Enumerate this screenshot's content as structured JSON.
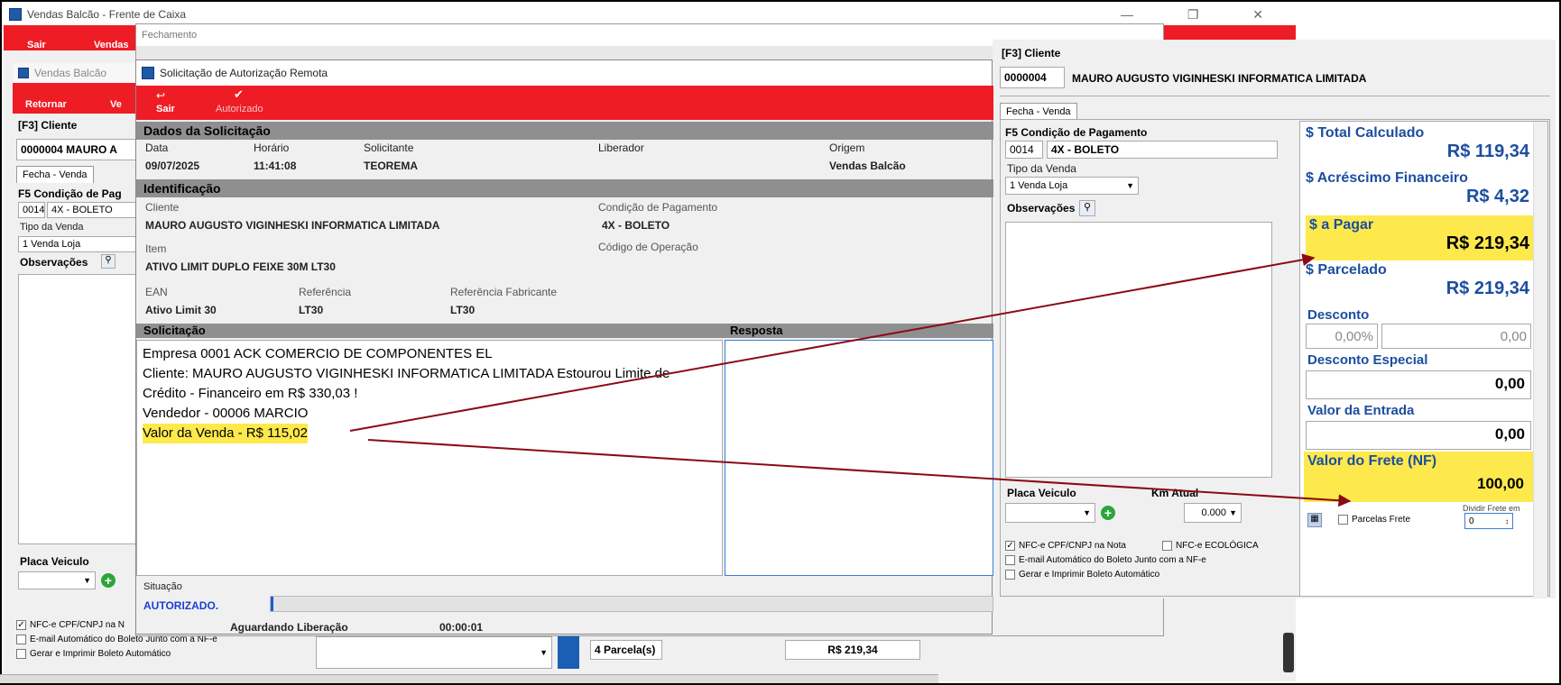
{
  "bg_window": {
    "title": "Vendas Balcão - Frente de Caixa",
    "btn_sair": "Sair",
    "btn_vendas": "Vendas"
  },
  "mid_window": {
    "title": "Fechamento"
  },
  "left_panel": {
    "title": "Vendas Balcão",
    "btn_retornar": "Retornar",
    "btn_ve": "Ve",
    "cliente_label": "[F3] Cliente",
    "cliente_code": "0000004",
    "cliente_name": "MAURO A",
    "tab": "Fecha - Venda",
    "cond_label": "F5 Condição de Pag",
    "cond_code": "0014",
    "cond_name": "4X - BOLETO",
    "tipo_label": "Tipo da Venda",
    "tipo_value": "1 Venda Loja",
    "obs_label": "Observações",
    "placa_label": "Placa Veiculo"
  },
  "bottom_left": {
    "chk1": "NFC-e CPF/CNPJ na N",
    "chk2": "E-mail Automático do Boleto Junto com a NF-e",
    "chk3": "Gerar e Imprimir Boleto Automático"
  },
  "bottom_bar": {
    "parcelas": "4 Parcela(s)",
    "total": "R$ 219,34"
  },
  "dialog": {
    "title": "Solicitação de Autorização Remota",
    "btn_sair": "Sair",
    "btn_autorizado": "Autorizado",
    "sec_dados": "Dados da Solicitação",
    "col_data": "Data",
    "col_horario": "Horário",
    "col_solicitante": "Solicitante",
    "col_liberador": "Liberador",
    "col_origem": "Origem",
    "val_data": "09/07/2025",
    "val_horario": "11:41:08",
    "val_solicitante": "TEOREMA",
    "val_liberador": "",
    "val_origem": "Vendas Balcão",
    "sec_ident": "Identificação",
    "lbl_cliente": "Cliente",
    "val_cliente": "MAURO AUGUSTO VIGINHESKI INFORMATICA LIMITADA",
    "lbl_cond": "Condição de Pagamento",
    "val_cond": "4X - BOLETO",
    "lbl_item": "Item",
    "val_item": "ATIVO LIMIT DUPLO FEIXE 30M LT30",
    "lbl_codop": "Código de Operação",
    "lbl_ean": "EAN",
    "val_ean": "Ativo Limit 30",
    "lbl_ref": "Referência",
    "val_ref": "LT30",
    "lbl_reffab": "Referência Fabricante",
    "val_reffab": "LT30",
    "sec_solic": "Solicitação",
    "sec_resp": "Resposta",
    "solic_lines": [
      "Empresa 0001 ACK COMERCIO DE COMPONENTES EL",
      "Cliente: MAURO AUGUSTO VIGINHESKI INFORMATICA LIMITADA Estourou Limite de",
      "Crédito - Financeiro em R$ 330,03 !",
      "Vendedor - 00006 MARCIO"
    ],
    "solic_highlight": "Valor da Venda - R$ 115,02",
    "lbl_situacao": "Situação",
    "val_situacao": "AUTORIZADO.",
    "status_text": "Aguardando Liberação",
    "status_time": "00:00:01"
  },
  "right_panel": {
    "cliente_label": "[F3] Cliente",
    "cliente_code": "0000004",
    "cliente_name": "MAURO AUGUSTO VIGINHESKI INFORMATICA LIMITADA",
    "tab": "Fecha - Venda",
    "cond_label": "F5 Condição de Pagamento",
    "cond_code": "0014",
    "cond_name": "4X - BOLETO",
    "tipo_label": "Tipo da Venda",
    "tipo_value": "1 Venda Loja",
    "obs_label": "Observações",
    "placa_label": "Placa Veiculo",
    "km_label": "Km Atual",
    "km_value": "0.000",
    "chk_nfce": "NFC-e CPF/CNPJ na Nota",
    "chk_eco": "NFC-e ECOLÓGICA",
    "chk_email": "E-mail Automático do Boleto Junto com a NF-e",
    "chk_boleto": "Gerar e Imprimir Boleto Automático"
  },
  "totals": {
    "total_calc_label": "$ Total Calculado",
    "total_calc": "R$ 119,34",
    "acresc_label": "$ Acréscimo Financeiro",
    "acresc": "R$ 4,32",
    "apagar_label": "$ a Pagar",
    "apagar": "R$ 219,34",
    "parcelado_label": "$ Parcelado",
    "parcelado": "R$ 219,34",
    "desconto_label": "Desconto",
    "desconto_pct": "0,00%",
    "desconto_val": "0,00",
    "desc_esp_label": "Desconto Especial",
    "desc_esp": "0,00",
    "entrada_label": "Valor da Entrada",
    "entrada": "0,00",
    "frete_label": "Valor do Frete (NF)",
    "frete": "100,00",
    "dividir_label": "Dividir Frete em",
    "parcelas_frete": "Parcelas Frete",
    "dividir_value": "0"
  },
  "colors": {
    "red": "#ee1c25",
    "blue_text": "#1c4ea0",
    "highlight": "#fde94b",
    "arrow": "#8b0a14"
  }
}
